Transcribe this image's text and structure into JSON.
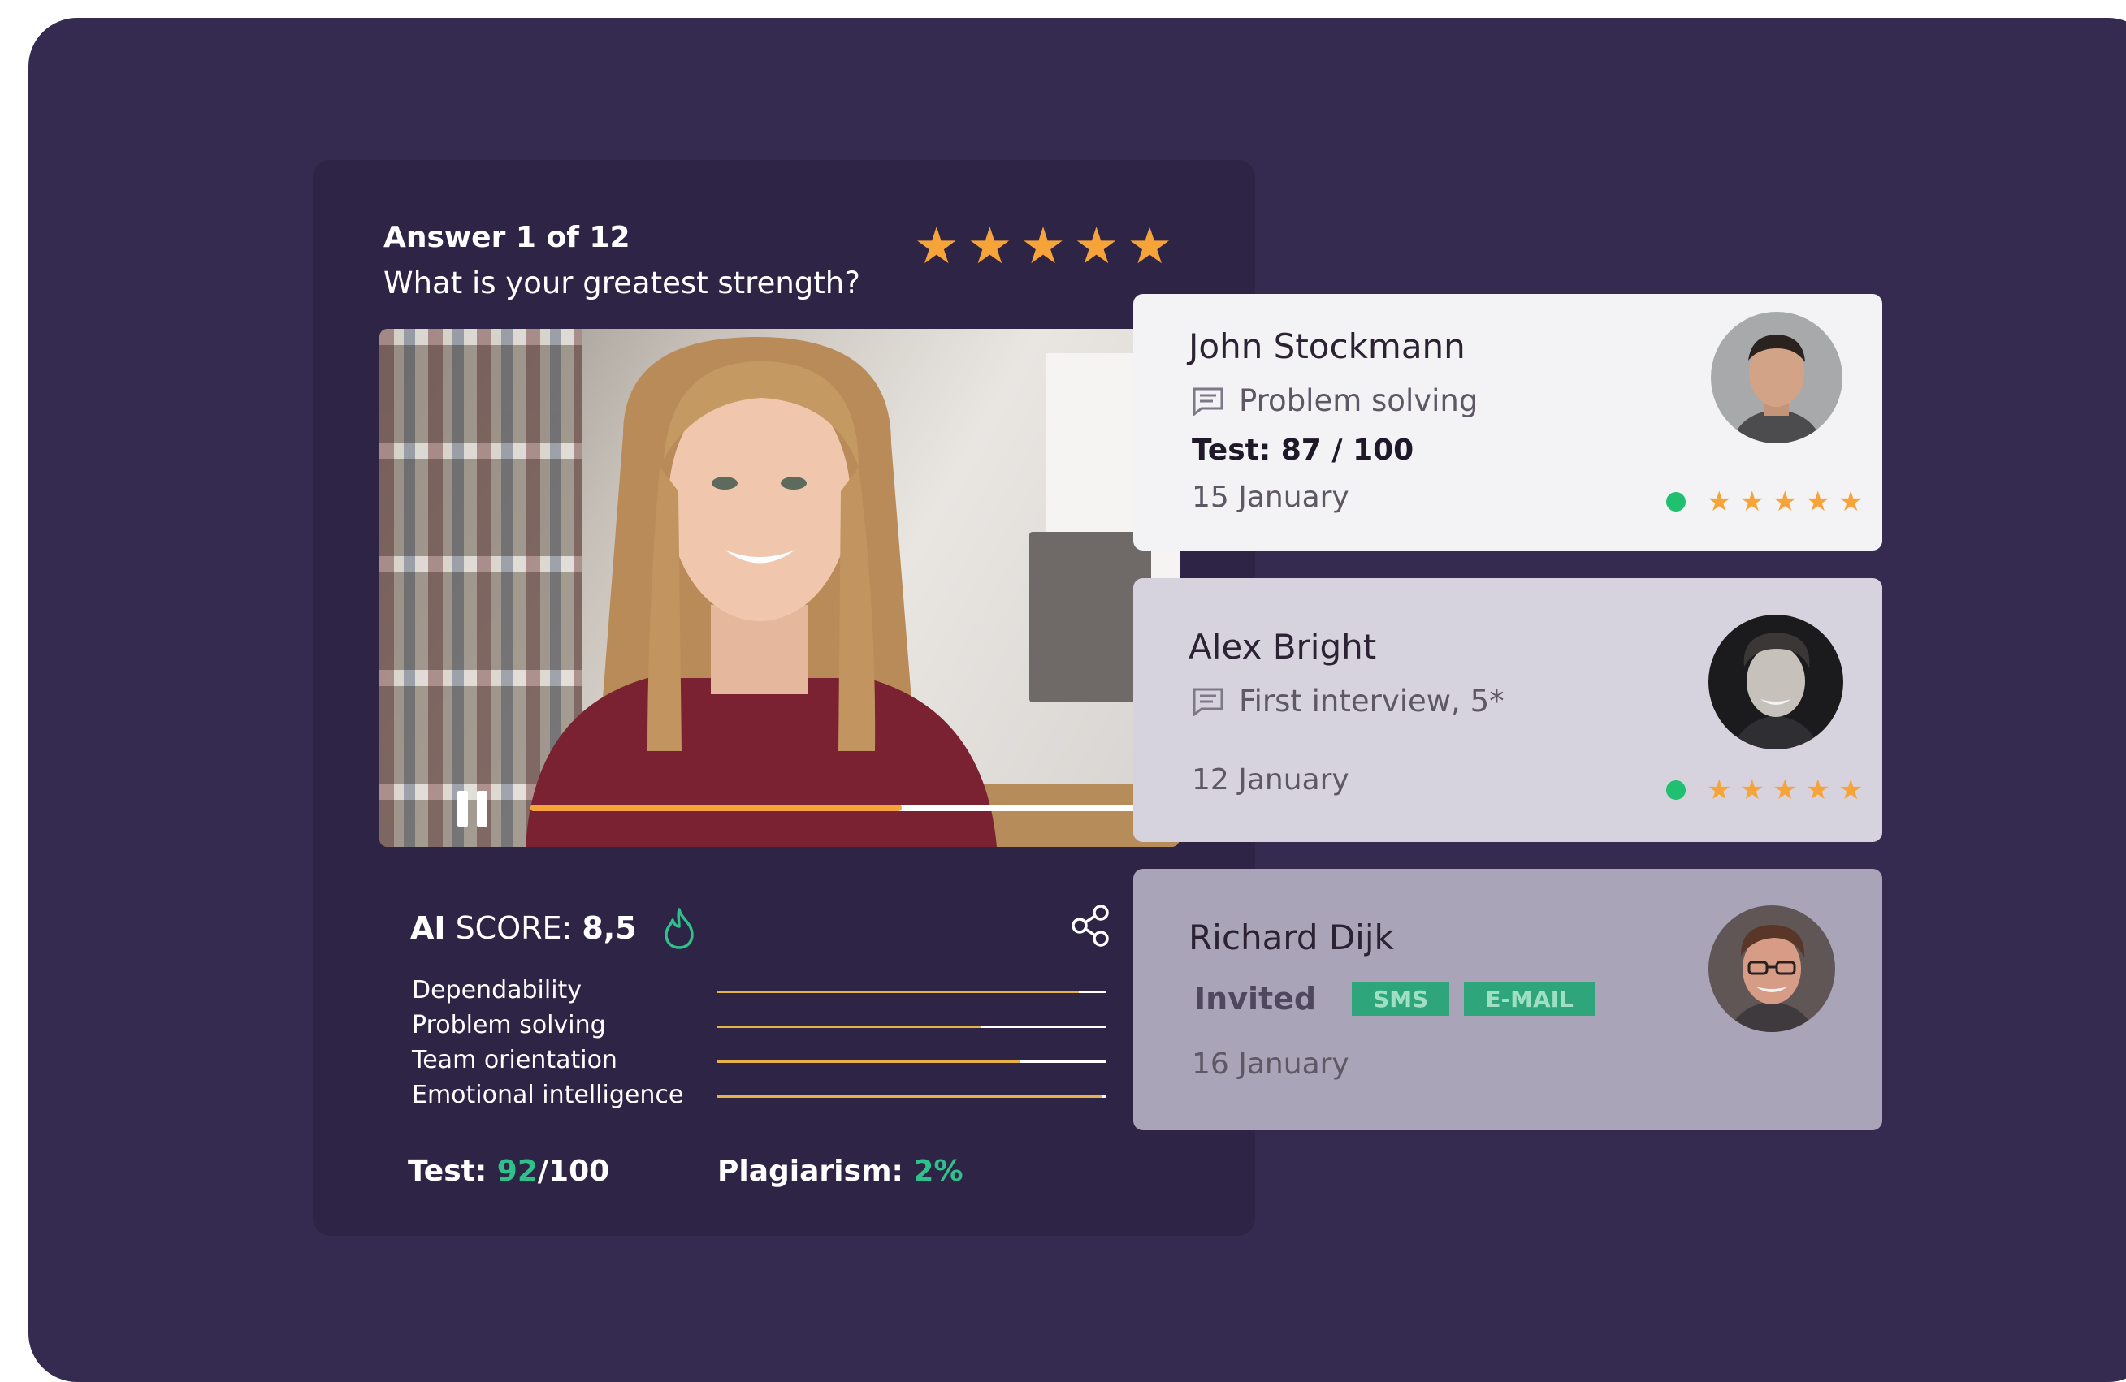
{
  "main_card": {
    "answer_title": "Answer 1 of 12",
    "question": "What is your greatest strength?",
    "rating_stars": 5,
    "video": {
      "progress": 0.59
    },
    "ai_score": {
      "prefix": "AI",
      "label": "SCORE:",
      "value": "8,5"
    },
    "skills": [
      {
        "label": "Dependability",
        "value": 0.93
      },
      {
        "label": "Problem solving",
        "value": 0.68
      },
      {
        "label": "Team orientation",
        "value": 0.78
      },
      {
        "label": "Emotional intelligence",
        "value": 0.99
      }
    ],
    "test": {
      "label": "Test:",
      "score": "92",
      "total": "/100"
    },
    "plagiarism": {
      "label": "Plagiarism:",
      "value": "2%"
    }
  },
  "candidates": [
    {
      "name": "John Stockmann",
      "note": "Problem solving",
      "test": "Test: 87 / 100",
      "date": "15 January",
      "rating_stars": 5
    },
    {
      "name": "Alex Bright",
      "note": "First interview, 5*",
      "date": "12 January",
      "rating_stars": 5
    },
    {
      "name": "Richard Dijk",
      "status": "Invited",
      "badges": [
        "SMS",
        "E-MAIL"
      ],
      "date": "16 January"
    }
  ],
  "colors": {
    "background": "#352a50",
    "card": "#2e2446",
    "accent_orange": "#f6a43a",
    "accent_green": "#2fc18c",
    "online": "#1fc06f"
  },
  "icons": [
    "star-icon",
    "pause-icon",
    "flame-icon",
    "share-icon",
    "comment-icon",
    "status-online-icon"
  ]
}
